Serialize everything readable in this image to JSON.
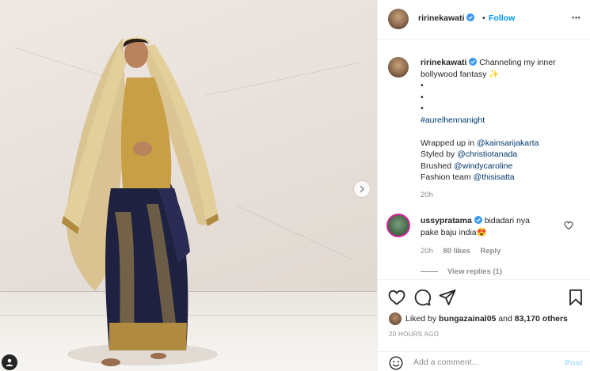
{
  "post": {
    "media_description_icon": "photo",
    "next_icon": "chevron-right-icon",
    "tag_icon": "user-icon"
  },
  "header": {
    "username": "ririnekawati",
    "separator": "•",
    "follow_label": "Follow",
    "more_icon": "ellipsis-icon",
    "more_label": "•••"
  },
  "caption": {
    "username": "ririnekawati",
    "lines": [
      "Channeling my inner",
      "bollywood fantasy ✨",
      "•",
      "•",
      "•"
    ],
    "hashtag": "#aurelhennanight",
    "credits": [
      {
        "prefix": "Wrapped up in ",
        "handle": "@kainsarijakarta"
      },
      {
        "prefix": "Styled by ",
        "handle": "@christiotanada"
      },
      {
        "prefix": "Brushed ",
        "handle": "@windycaroline"
      },
      {
        "prefix": "Fashion team ",
        "handle": "@thisisatta"
      }
    ],
    "time": "20h"
  },
  "comment": {
    "username": "ussypratama",
    "text_line1": "bidadari nya",
    "text_line2": "pake baju india😍",
    "time": "20h",
    "likes": "80 likes",
    "reply_label": "Reply",
    "view_replies": "View replies (1)"
  },
  "actions": {
    "liked_by_prefix": "Liked by ",
    "liked_by_user": "bungazainal05",
    "liked_by_suffix": " and ",
    "others": "83,170 others",
    "timestamp": "20 HOURS AGO"
  },
  "add_comment": {
    "placeholder": "Add a comment...",
    "post_label": "Post"
  },
  "colors": {
    "link": "#00376b",
    "follow": "#0095f6",
    "verified": "#3897f0",
    "muted": "#8e8e8e"
  }
}
